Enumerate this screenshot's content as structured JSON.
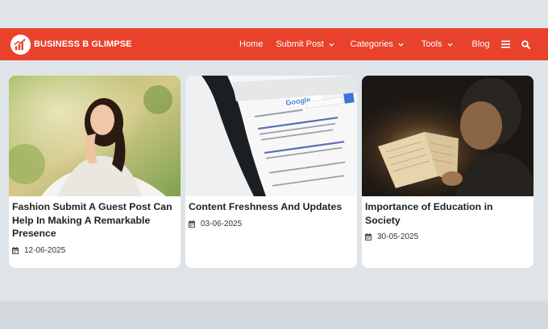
{
  "site": {
    "name": "BUSINESS B GLIMPSE",
    "brand_color": "#e8412c"
  },
  "nav": {
    "items": [
      {
        "label": "Home",
        "has_dropdown": false
      },
      {
        "label": "Submit Post",
        "has_dropdown": true
      },
      {
        "label": "Categories",
        "has_dropdown": true
      },
      {
        "label": "Tools",
        "has_dropdown": true
      },
      {
        "label": "Blog",
        "has_dropdown": false
      }
    ],
    "icons": [
      "bars-icon",
      "search-icon"
    ]
  },
  "posts": [
    {
      "title": "Fashion Submit A Guest Post Can Help In Making A Remarkable Presence",
      "date": "12-06-2025",
      "image": "woman-in-white-dress-photo"
    },
    {
      "title": "Content Freshness And Updates",
      "date": "03-06-2025",
      "image": "phone-search-results-photo"
    },
    {
      "title": "Importance of Education in Society",
      "date": "30-05-2025",
      "image": "child-reading-book-photo"
    }
  ]
}
